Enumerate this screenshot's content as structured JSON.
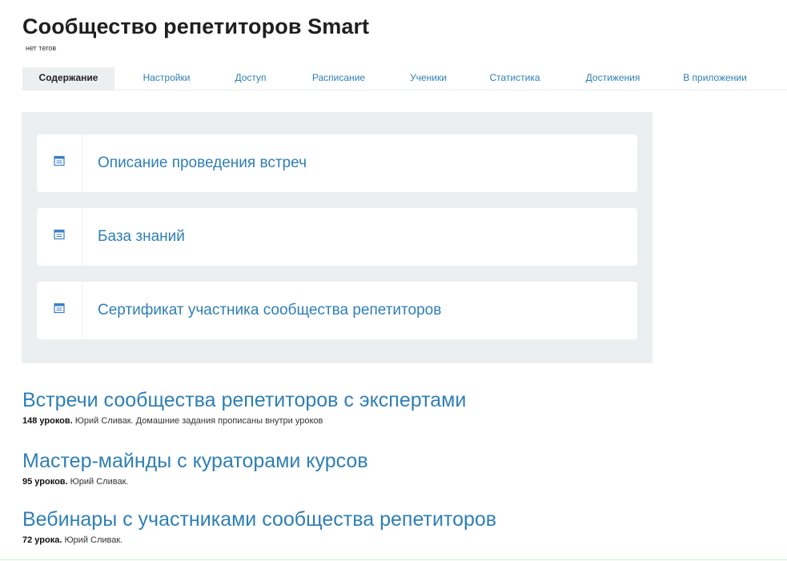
{
  "header": {
    "title": "Сообщество репетиторов Smart",
    "tags": "нет тегов"
  },
  "tabs": [
    {
      "label": "Содержание",
      "active": true
    },
    {
      "label": "Настройки",
      "active": false
    },
    {
      "label": "Доступ",
      "active": false
    },
    {
      "label": "Расписание",
      "active": false
    },
    {
      "label": "Ученики",
      "active": false
    },
    {
      "label": "Статистика",
      "active": false
    },
    {
      "label": "Достижения",
      "active": false
    },
    {
      "label": "В приложении",
      "active": false
    }
  ],
  "lessons": [
    {
      "label": "Описание проведения встреч",
      "icon": "lesson-page-icon"
    },
    {
      "label": "База знаний",
      "icon": "lesson-page-icon"
    },
    {
      "label": "Сертификат участника сообщества репетиторов",
      "icon": "lesson-page-icon"
    }
  ],
  "courses": [
    {
      "title": "Встречи сообщества репетиторов с экспертами",
      "count": "148 уроков.",
      "details": " Юрий Сливак. Домашние задания прописаны внутри уроков"
    },
    {
      "title": "Мастер-майнды с кураторами курсов",
      "count": "95 уроков.",
      "details": " Юрий Сливак."
    },
    {
      "title": "Вебинары с участниками сообщества репетиторов",
      "count": "72 урока.",
      "details": " Юрий Сливак."
    }
  ],
  "colors": {
    "link": "#2f7fb5",
    "panel_bg": "#eceff0",
    "active_tab_bg": "#eceff0",
    "icon_blue": "#3b7fc4"
  }
}
